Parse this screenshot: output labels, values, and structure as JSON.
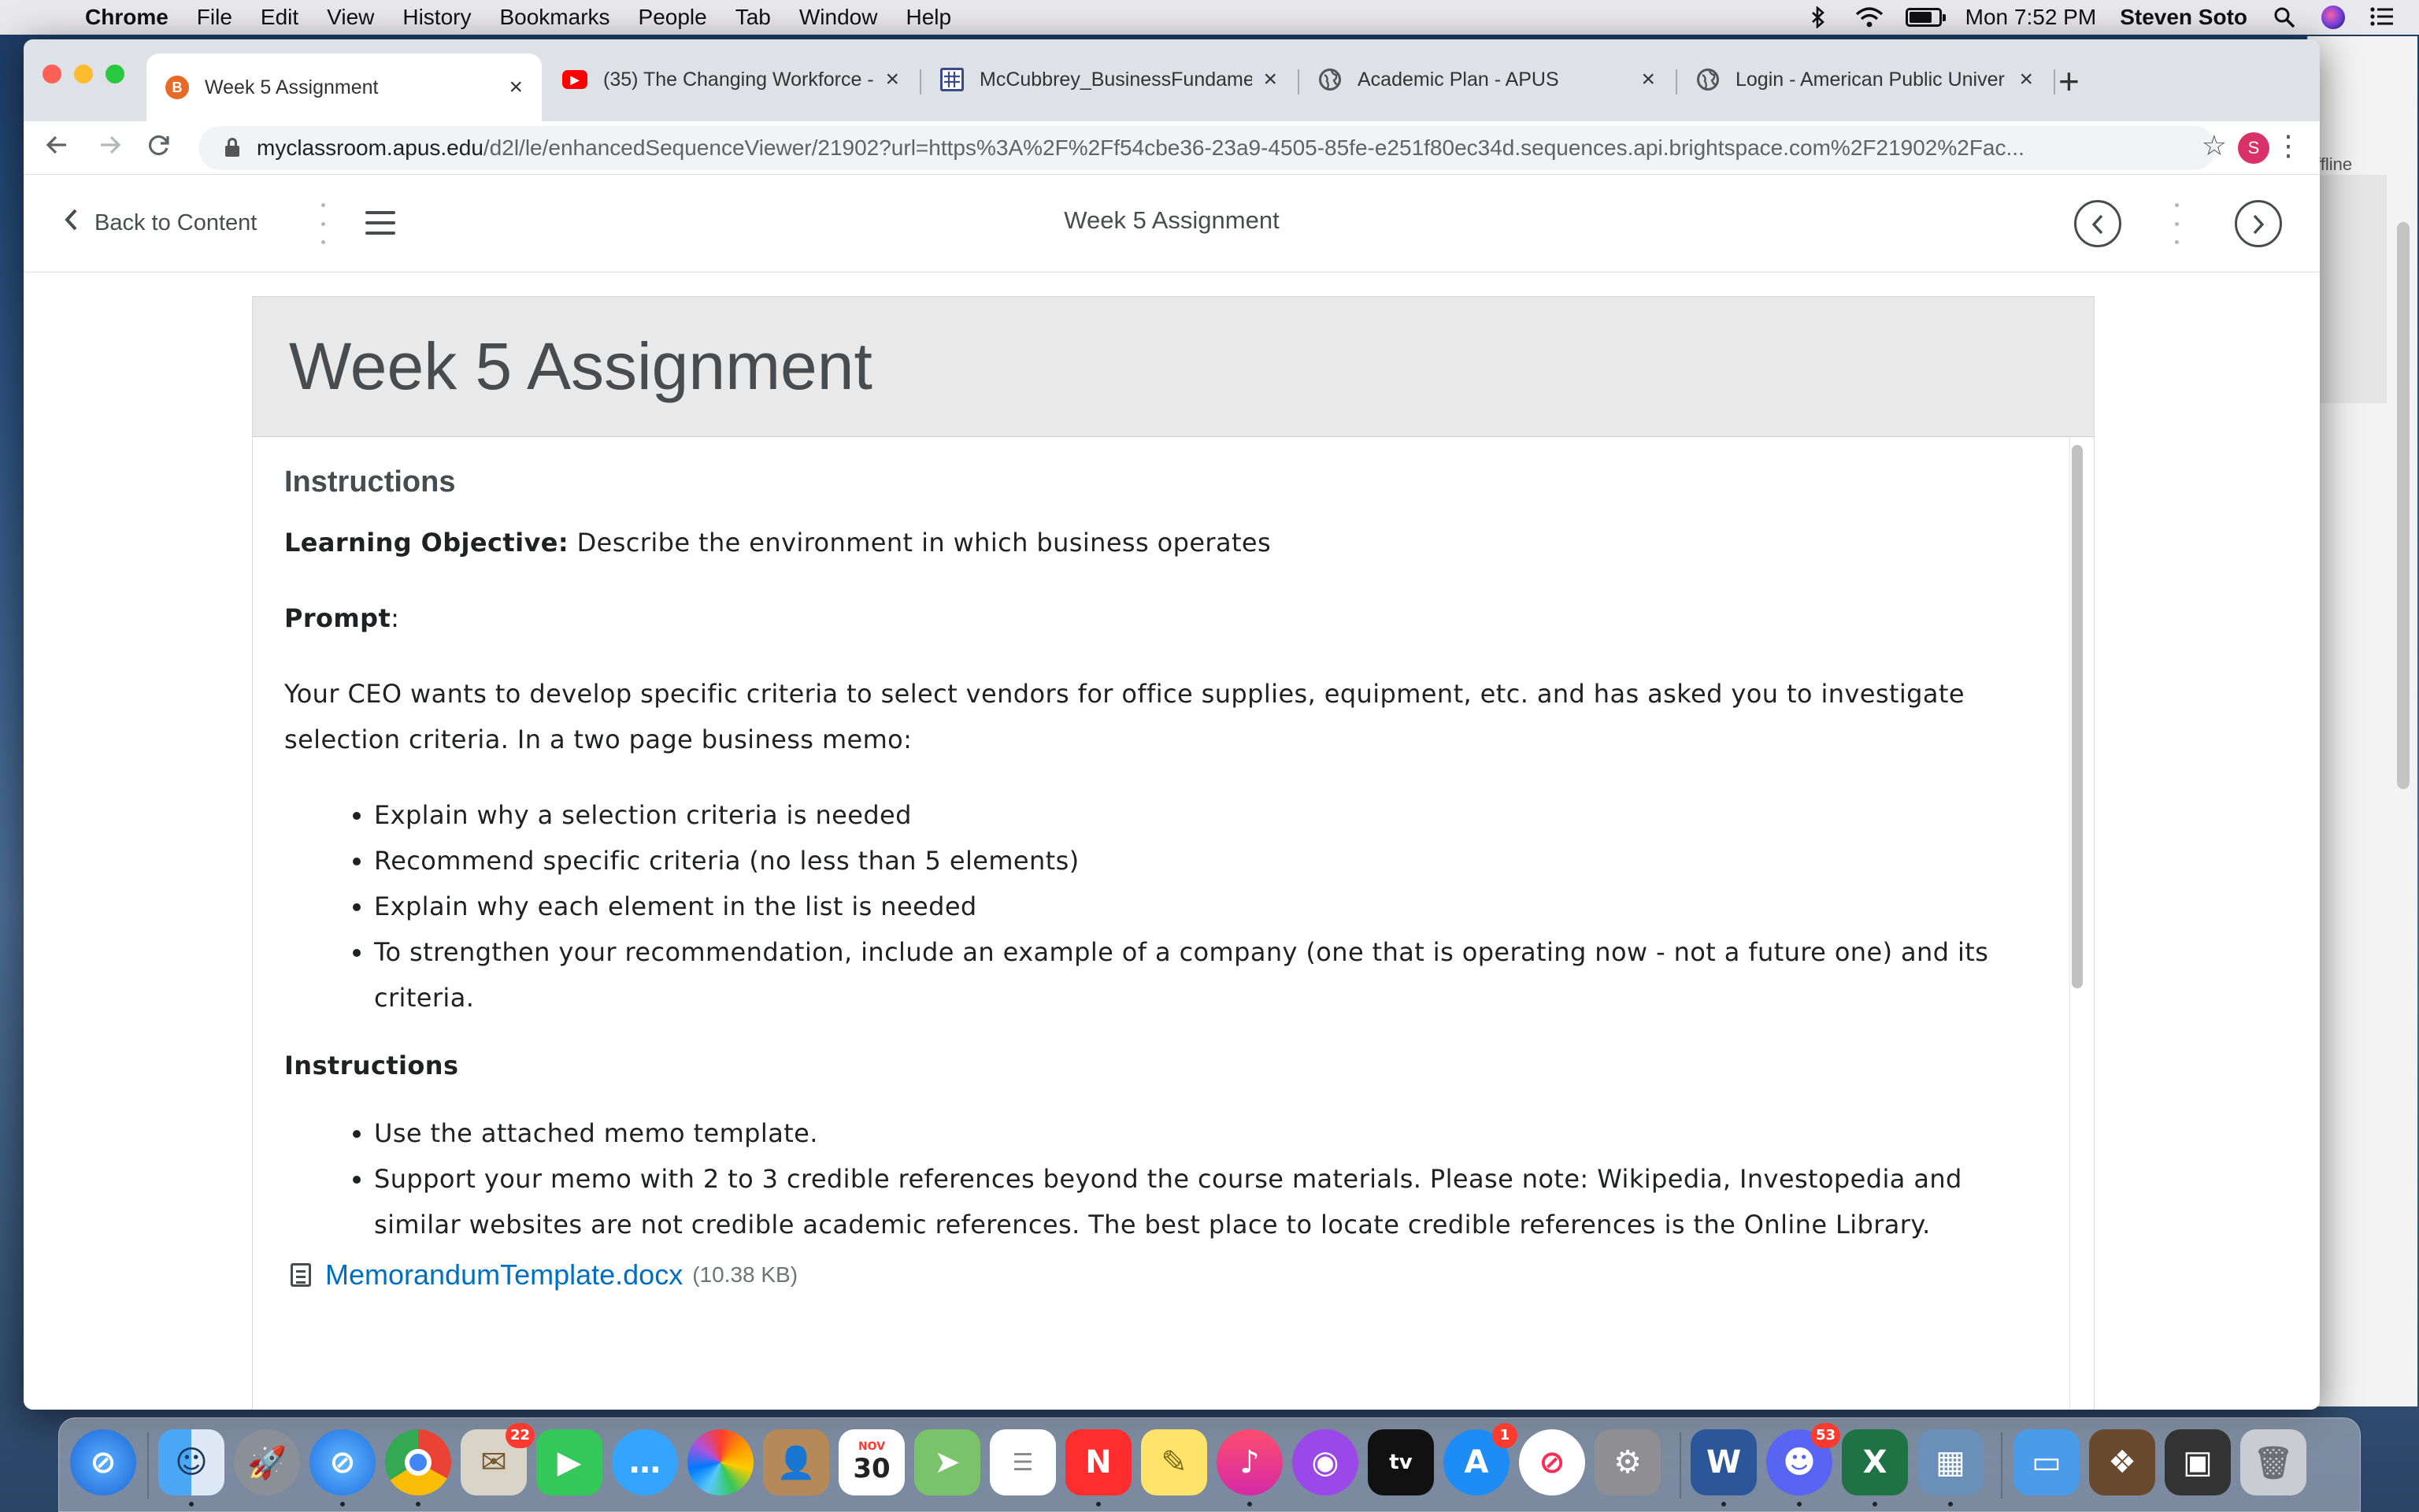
{
  "menubar": {
    "app": "Chrome",
    "items": [
      "File",
      "Edit",
      "View",
      "History",
      "Bookmarks",
      "People",
      "Tab",
      "Window",
      "Help"
    ],
    "clock": "Mon 7:52 PM",
    "user": "Steven Soto"
  },
  "tabs": [
    {
      "title": "Week 5 Assignment",
      "icon": "brightspace-favicon",
      "active": true
    },
    {
      "title": "(35) The Changing Workforce -",
      "icon": "youtube-favicon",
      "active": false
    },
    {
      "title": "McCubbrey_BusinessFundame",
      "icon": "grid-favicon",
      "active": false
    },
    {
      "title": "Academic Plan - APUS",
      "icon": "globe-favicon",
      "active": false
    },
    {
      "title": "Login - American Public Univer",
      "icon": "globe-favicon",
      "active": false
    }
  ],
  "address": {
    "host": "myclassroom.apus.edu",
    "path": "/d2l/le/enhancedSequenceViewer/21902?url=https%3A%2F%2Ff54cbe36-23a9-4505-85fe-e251f80ec34d.sequences.api.brightspace.com%2F21902%2Fac..."
  },
  "profile_initial": "S",
  "viewer": {
    "back_label": "Back to Content",
    "title": "Week 5 Assignment"
  },
  "page": {
    "title": "Week 5 Assignment",
    "instructions_heading": "Instructions",
    "objective_label": "Learning Objective:",
    "objective_text": " Describe the environment in which business operates",
    "prompt_label": "Prompt",
    "prompt_colon": ":",
    "prompt_text": "Your CEO wants to develop specific criteria to select vendors for office supplies, equipment, etc. and has asked you to investigate selection criteria. In a two page business memo:",
    "prompt_bullets": [
      "Explain why a selection criteria is needed",
      "Recommend specific criteria (no less than 5 elements)",
      "Explain why each element in the list is needed",
      "To strengthen your recommendation, include an example of a company (one that is operating now - not a future one) and its criteria."
    ],
    "instructions_subheading": "Instructions",
    "instruction_bullets": [
      "Use the attached memo template.",
      "Support your memo with 2 to 3 credible references beyond the course materials. Please note: Wikipedia, Investopedia and similar websites are not credible academic references. The best place to locate credible references is the Online Library."
    ],
    "attachment_name": "MemorandumTemplate.docx",
    "attachment_size": "(10.38 KB)"
  },
  "background_window": {
    "label": "ffline"
  },
  "dock": {
    "badges": {
      "mail": "22",
      "appstore": "1",
      "discord": "53"
    },
    "calendar_month": "NOV",
    "calendar_day": "30"
  }
}
